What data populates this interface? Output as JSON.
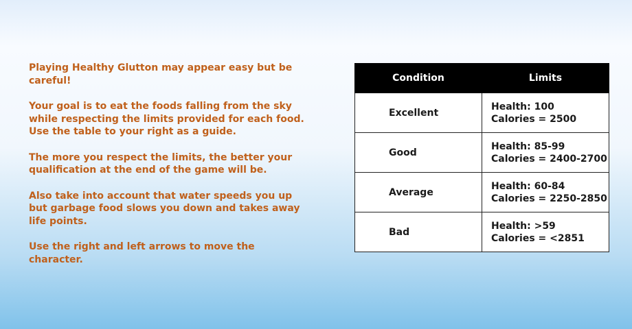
{
  "instructions": {
    "paragraphs": [
      "Playing Healthy Glutton may appear easy but be careful!",
      "Your goal is to eat the foods falling from the sky while respecting the limits provided for each food. Use the table to your right as a guide.",
      "The more you respect the limits, the better your qualification at the end of the game will be.",
      "Also take into account that water speeds you up but garbage food slows you down and takes away life points.",
      "Use the right and left arrows to move the character."
    ]
  },
  "table": {
    "headers": [
      "Condition",
      "Limits"
    ],
    "rows": [
      {
        "condition": "Excellent",
        "health": "Health: 100",
        "calories": "Calories = 2500"
      },
      {
        "condition": "Good",
        "health": "Health: 85-99",
        "calories": "Calories = 2400-2700"
      },
      {
        "condition": "Average",
        "health": "Health: 60-84",
        "calories": "Calories = 2250-2850"
      },
      {
        "condition": "Bad",
        "health": "Health: >59",
        "calories": "Calories = <2851"
      }
    ]
  },
  "colors": {
    "instruction_text": "#c0601b",
    "table_header_bg": "#000000",
    "table_header_text": "#ffffff"
  }
}
